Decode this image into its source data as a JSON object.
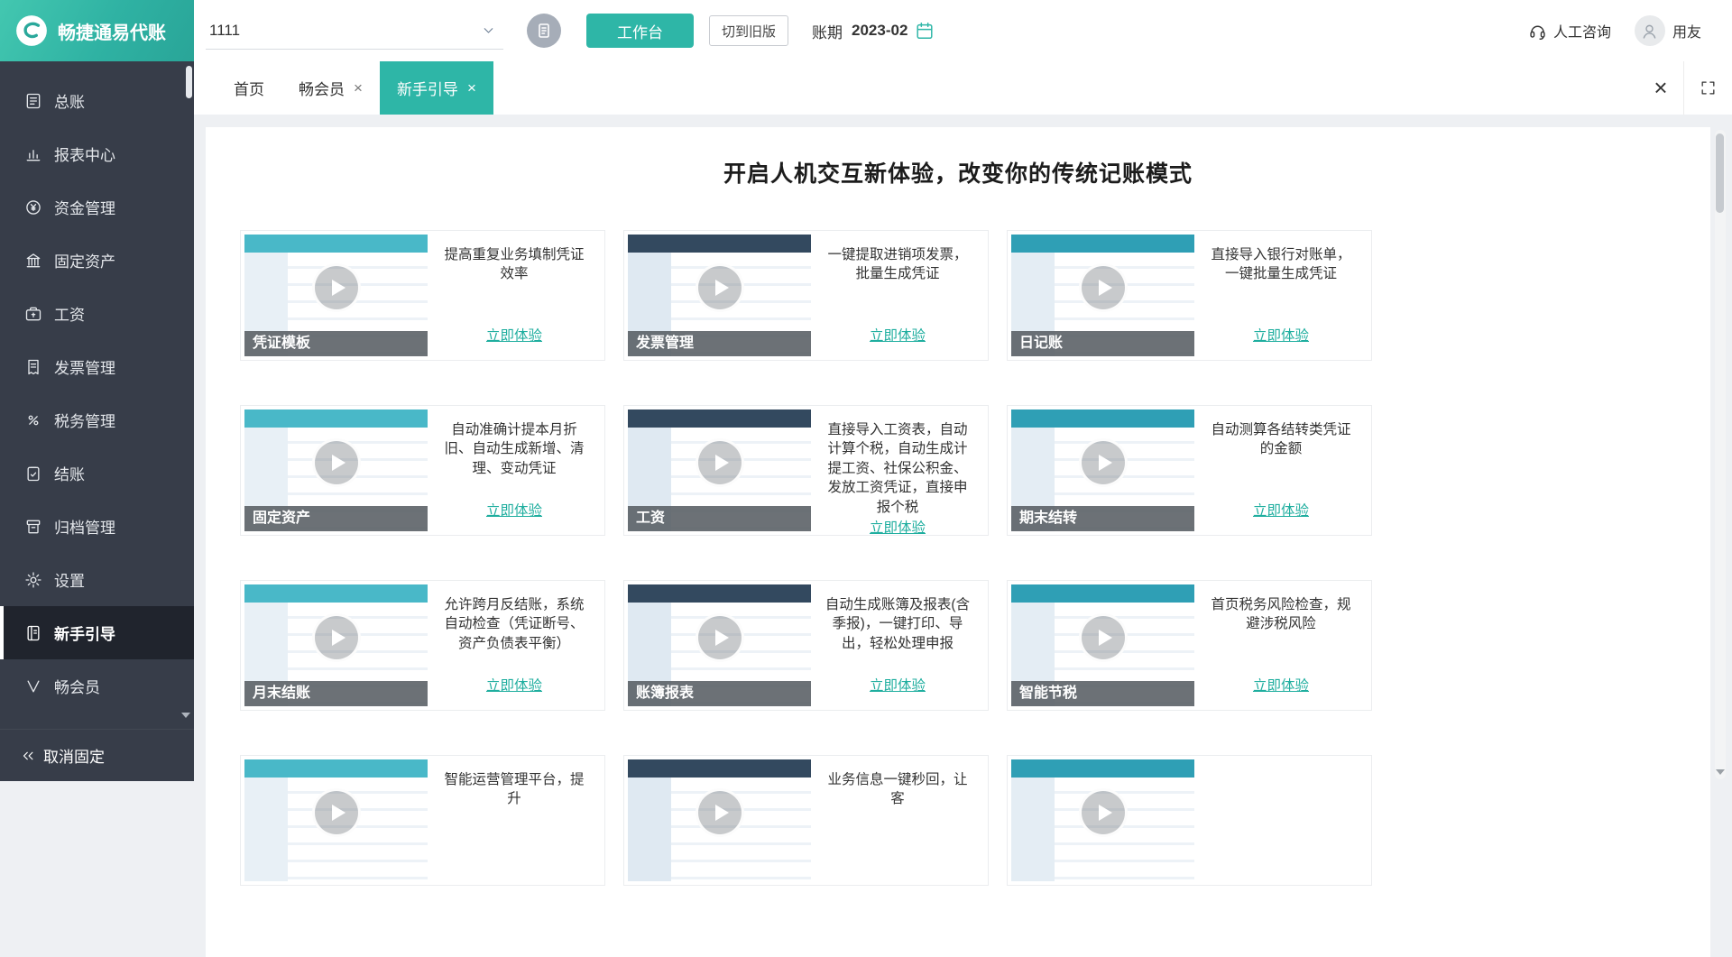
{
  "header": {
    "brand": "畅捷通易代账",
    "account_value": "1111",
    "workbench_label": "工作台",
    "old_version_label": "切到旧版",
    "period_label": "账期",
    "period_value": "2023-02",
    "support_label": "人工咨询",
    "user_name": "用友"
  },
  "tabs": [
    {
      "label": "首页",
      "closable": false,
      "active": false
    },
    {
      "label": "畅会员",
      "closable": true,
      "active": false
    },
    {
      "label": "新手引导",
      "closable": true,
      "active": true
    }
  ],
  "sidebar": {
    "items": [
      {
        "label": "总账",
        "icon": "ledger-icon",
        "active": false
      },
      {
        "label": "报表中心",
        "icon": "report-center-icon",
        "active": false
      },
      {
        "label": "资金管理",
        "icon": "funds-icon",
        "active": false
      },
      {
        "label": "固定资产",
        "icon": "fixed-assets-icon",
        "active": false
      },
      {
        "label": "工资",
        "icon": "salary-icon",
        "active": false
      },
      {
        "label": "发票管理",
        "icon": "invoice-icon",
        "active": false
      },
      {
        "label": "税务管理",
        "icon": "tax-icon",
        "active": false
      },
      {
        "label": "结账",
        "icon": "closing-icon",
        "active": false
      },
      {
        "label": "归档管理",
        "icon": "archive-icon",
        "active": false
      },
      {
        "label": "设置",
        "icon": "settings-icon",
        "active": false
      },
      {
        "label": "新手引导",
        "icon": "guide-icon",
        "active": true
      },
      {
        "label": "畅会员",
        "icon": "member-icon",
        "active": false
      }
    ],
    "unpin_label": "取消固定"
  },
  "main": {
    "title": "开启人机交互新体验，改变你的传统记账模式",
    "cards": [
      {
        "label": "凭证模板",
        "desc": "提高重复业务填制凭证效率",
        "cta": "立即体验"
      },
      {
        "label": "发票管理",
        "desc": "一键提取进销项发票，批量生成凭证",
        "cta": "立即体验"
      },
      {
        "label": "日记账",
        "desc": "直接导入银行对账单，一键批量生成凭证",
        "cta": "立即体验"
      },
      {
        "label": "固定资产",
        "desc": "自动准确计提本月折旧、自动生成新增、清理、变动凭证",
        "cta": "立即体验"
      },
      {
        "label": "工资",
        "desc": "直接导入工资表，自动计算个税，自动生成计提工资、社保公积金、发放工资凭证，直接申报个税",
        "cta": "立即体验"
      },
      {
        "label": "期末结转",
        "desc": "自动测算各结转类凭证的金额",
        "cta": "立即体验"
      },
      {
        "label": "月末结账",
        "desc": "允许跨月反结账，系统自动检查（凭证断号、资产负债表平衡）",
        "cta": "立即体验"
      },
      {
        "label": "账簿报表",
        "desc": "自动生成账簿及报表(含季报)，一键打印、导出，轻松处理申报",
        "cta": "立即体验"
      },
      {
        "label": "智能节税",
        "desc": "首页税务风险检查，规避涉税风险",
        "cta": "立即体验"
      },
      {
        "label": "",
        "desc": "智能运营管理平台，提升",
        "cta": ""
      },
      {
        "label": "",
        "desc": "业务信息一键秒回，让客",
        "cta": ""
      },
      {
        "label": "",
        "desc": "",
        "cta": ""
      }
    ]
  },
  "colors": {
    "accent": "#2eb6a7",
    "sidebar_bg": "#373d49",
    "link": "#1fae9f"
  }
}
